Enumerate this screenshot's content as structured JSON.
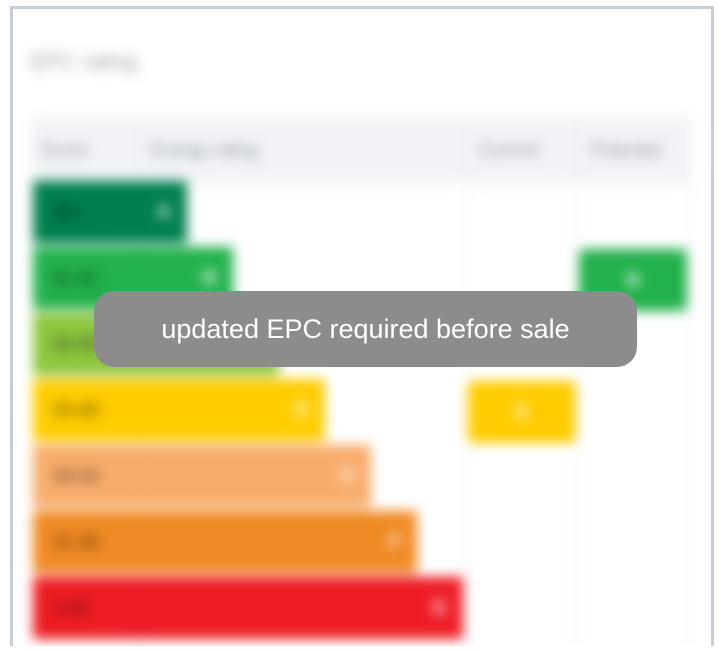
{
  "card": {
    "title": "EPC rating",
    "columns": {
      "score": "Score",
      "rating": "Energy rating",
      "current": "Current",
      "potential": "Potential"
    }
  },
  "bands": [
    {
      "score": "92+",
      "letter": "A",
      "color": "#007f4e"
    },
    {
      "score": "81-91",
      "letter": "B",
      "color": "#22b14c"
    },
    {
      "score": "69-80",
      "letter": "C",
      "color": "#8dc63f"
    },
    {
      "score": "55-68",
      "letter": "D",
      "color": "#ffcc00"
    },
    {
      "score": "39-54",
      "letter": "E",
      "color": "#f7ac6b"
    },
    {
      "score": "21-38",
      "letter": "F",
      "color": "#f08a24"
    },
    {
      "score": "1-20",
      "letter": "G",
      "color": "#ed1c24"
    }
  ],
  "current": {
    "label": "D",
    "color": "#ffcc00"
  },
  "potential": {
    "label": "B",
    "color": "#22b14c"
  },
  "toast": {
    "message": "updated EPC required before sale"
  }
}
